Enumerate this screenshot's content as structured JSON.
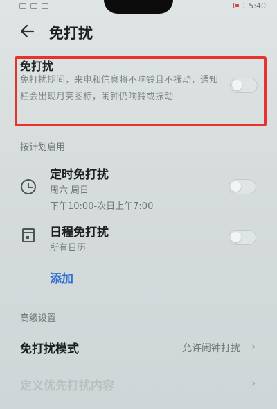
{
  "status": {
    "time": "5:40"
  },
  "header": {
    "title": "免打扰"
  },
  "dnd": {
    "title": "免打扰",
    "description": "免打扰期间，来电和信息将不响铃且不振动，通知栏会出现月亮图标，闹钟仍响铃或振动",
    "enabled": false
  },
  "schedule": {
    "section_label": "按计划启用",
    "timed": {
      "title": "定时免打扰",
      "days": "周六 周日",
      "range": "下午10:00-次日上午7:00",
      "enabled": false
    },
    "calendar": {
      "title": "日程免打扰",
      "subtitle": "所有日历",
      "enabled": false
    },
    "add_label": "添加"
  },
  "advanced": {
    "section_label": "高级设置",
    "mode": {
      "title": "免打扰模式",
      "value": "允许闹钟打扰"
    },
    "priority": {
      "title": "定义优先打扰内容"
    }
  },
  "colors": {
    "accent": "#2f6fd0",
    "highlight_border": "#e8322e"
  }
}
